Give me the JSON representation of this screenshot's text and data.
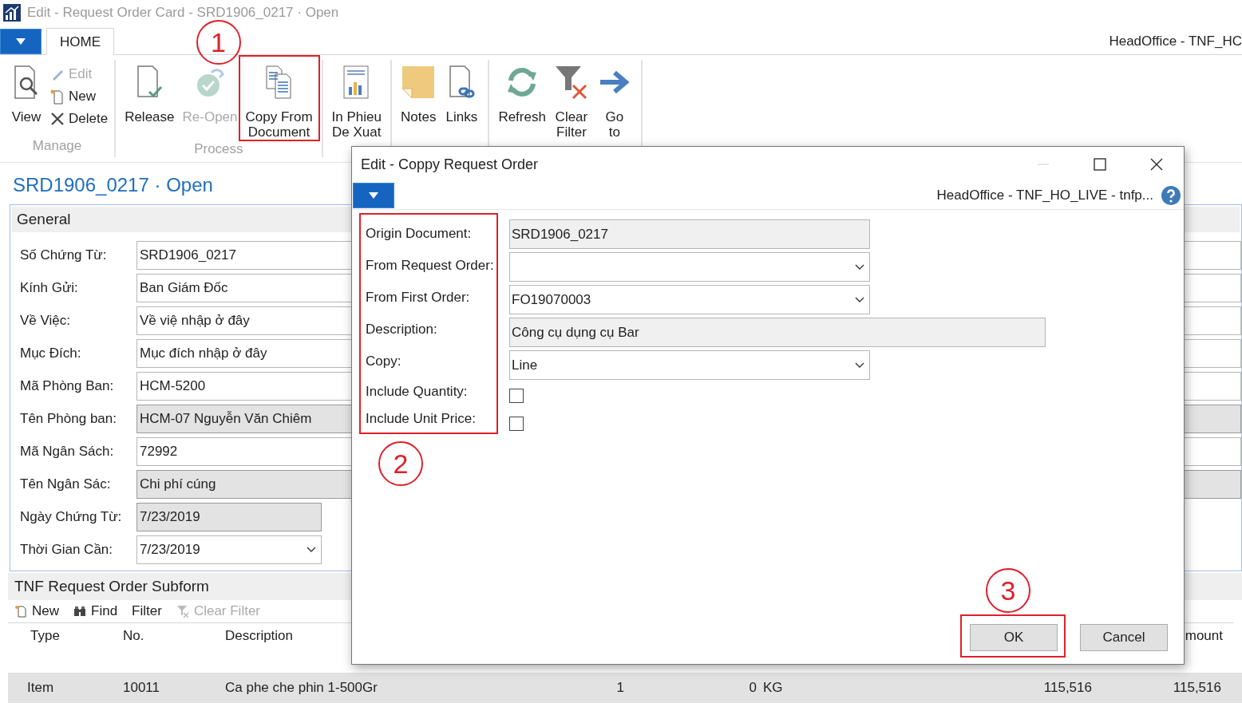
{
  "window": {
    "title": "Edit - Request Order Card - SRD1906_0217 · Open"
  },
  "tabs": [
    {
      "label": "HOME",
      "selected": true
    }
  ],
  "company": "HeadOffice - TNF_HC",
  "ribbon": [
    {
      "label": "Manage",
      "items": [
        {
          "label": "View",
          "kind": "large",
          "disabled": false
        },
        {
          "label": "Edit",
          "kind": "small",
          "disabled": true
        },
        {
          "label": "New",
          "kind": "small",
          "disabled": false
        },
        {
          "label": "Delete",
          "kind": "small",
          "disabled": false
        }
      ]
    },
    {
      "label": "Process",
      "items": [
        {
          "label": "Release",
          "kind": "large",
          "disabled": false
        },
        {
          "label": "Re-Open",
          "kind": "large",
          "disabled": true
        },
        {
          "label": "Copy From\nDocument",
          "kind": "large",
          "disabled": false,
          "callout": "1"
        }
      ]
    },
    {
      "items": [
        {
          "label": "In Phieu\nDe Xuat",
          "kind": "large",
          "disabled": false
        }
      ]
    },
    {
      "items": [
        {
          "label": "Notes",
          "kind": "large",
          "disabled": false
        },
        {
          "label": "Links",
          "kind": "large",
          "disabled": false
        }
      ]
    },
    {
      "items": [
        {
          "label": "Refresh",
          "kind": "large",
          "disabled": false
        },
        {
          "label": "Clear\nFilter",
          "kind": "large",
          "disabled": false
        },
        {
          "label": "Go\nto",
          "kind": "large",
          "disabled": false
        }
      ]
    }
  ],
  "page_title": "SRD1906_0217 · Open",
  "general": {
    "title": "General",
    "fields": [
      {
        "label": "Số Chứng Từ:",
        "value": "SRD1906_0217",
        "readonly": false,
        "dropdown": false,
        "short": false
      },
      {
        "label": "Kính Gửi:",
        "value": "Ban Giám Đốc",
        "readonly": false,
        "dropdown": false,
        "short": false
      },
      {
        "label": "Về Việc:",
        "value": "Về việ nhập ở đây",
        "readonly": false,
        "dropdown": false,
        "short": false
      },
      {
        "label": "Mục Đích:",
        "value": "Mục đích nhập ở đây",
        "readonly": false,
        "dropdown": false,
        "short": false
      },
      {
        "label": "Mã Phòng Ban:",
        "value": "HCM-5200",
        "readonly": false,
        "dropdown": false,
        "short": false
      },
      {
        "label": "Tên Phòng ban:",
        "value": "HCM-07 Nguyễn Văn Chiêm",
        "readonly": true,
        "dropdown": false,
        "short": false
      },
      {
        "label": "Mã Ngân Sách:",
        "value": "72992",
        "readonly": false,
        "dropdown": false,
        "short": false
      },
      {
        "label": "Tên Ngân Sác:",
        "value": "Chi phí cúng",
        "readonly": true,
        "dropdown": false,
        "short": false
      },
      {
        "label": "Ngày Chứng Từ:",
        "value": "7/23/2019",
        "readonly": true,
        "dropdown": false,
        "short": true
      },
      {
        "label": "Thời Gian Cần:",
        "value": "7/23/2019",
        "readonly": false,
        "dropdown": true,
        "short": true
      }
    ]
  },
  "subform": {
    "title": "TNF Request Order Subform",
    "actions": [
      {
        "label": "New",
        "disabled": false
      },
      {
        "label": "Find",
        "disabled": false
      },
      {
        "label": "Filter",
        "disabled": false
      },
      {
        "label": "Clear Filter",
        "disabled": true
      }
    ],
    "columns": [
      "Type",
      "No.",
      "Description",
      "",
      "",
      "",
      "",
      "mount"
    ],
    "rows": [
      {
        "selected": true,
        "cells": [
          "Item",
          "10011",
          "Ca phe che phin 1-500Gr",
          "1",
          "0",
          "KG",
          "115,516",
          "115,516"
        ]
      }
    ]
  },
  "dialog": {
    "title": "Edit - Coppy Request Order",
    "company": "HeadOffice - TNF_HO_LIVE - tnfp...",
    "labels_callout": "2",
    "fields": [
      {
        "label": "Origin Document:",
        "kind": "text",
        "value": "SRD1906_0217",
        "readonly": true,
        "wide": false
      },
      {
        "label": "From Request Order:",
        "kind": "dropdown",
        "readonly": false,
        "wide": false
      },
      {
        "label": "From First Order:",
        "kind": "dropdown",
        "value": "FO19070003",
        "readonly": false,
        "wide": false
      },
      {
        "label": "Description:",
        "kind": "text",
        "value": "Công cụ dụng cụ Bar",
        "readonly": true,
        "wide": true
      },
      {
        "label": "Copy:",
        "kind": "dropdown",
        "value": "Line",
        "readonly": false,
        "wide": false
      },
      {
        "label": "Include Quantity:",
        "kind": "checkbox",
        "checked": false
      },
      {
        "label": "Include Unit Price:",
        "kind": "checkbox",
        "checked": false
      }
    ],
    "buttons": [
      {
        "label": "OK",
        "callout": "3"
      },
      {
        "label": "Cancel"
      }
    ]
  }
}
